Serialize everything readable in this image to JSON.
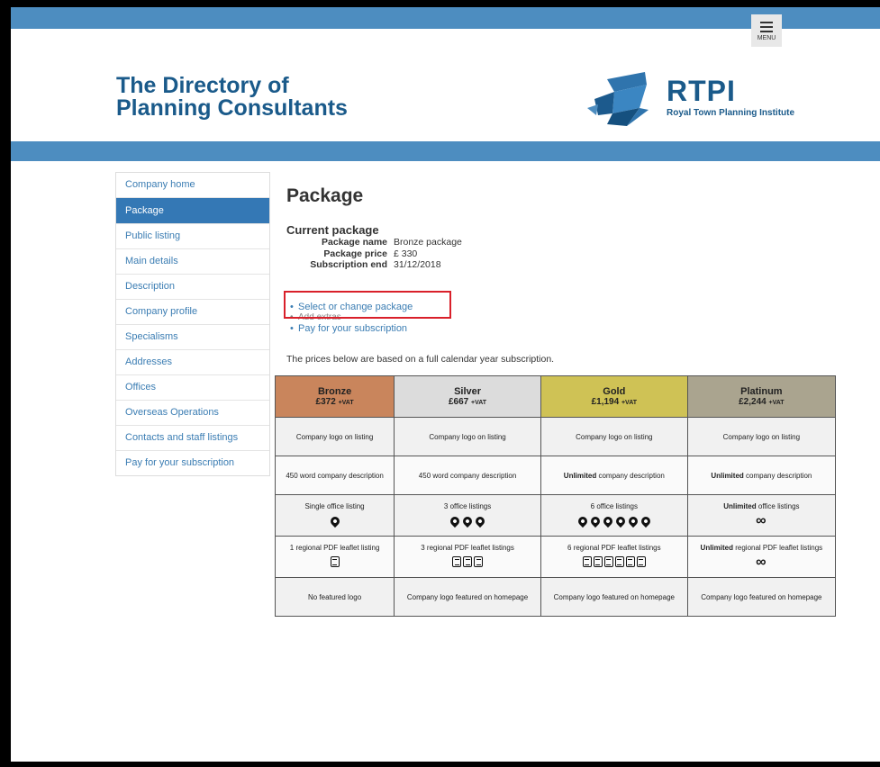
{
  "header": {
    "menu_label": "MENU",
    "site_title_line1": "The Directory of",
    "site_title_line2": "Planning Consultants",
    "logo_text": "RTPI",
    "logo_subtext": "Royal Town Planning Institute"
  },
  "sidebar": {
    "items": [
      {
        "label": "Company home"
      },
      {
        "label": "Package"
      },
      {
        "label": "Public listing"
      },
      {
        "label": "Main details"
      },
      {
        "label": "Description"
      },
      {
        "label": "Company profile"
      },
      {
        "label": "Specialisms"
      },
      {
        "label": "Addresses"
      },
      {
        "label": "Offices"
      },
      {
        "label": "Overseas Operations"
      },
      {
        "label": "Contacts and staff listings"
      },
      {
        "label": "Pay for your subscription"
      }
    ]
  },
  "main": {
    "heading": "Package",
    "current_package": {
      "title": "Current package",
      "name_label": "Package name",
      "name_value": "Bronze package",
      "price_label": "Package price",
      "price_value": "£ 330",
      "sub_end_label": "Subscription end",
      "sub_end_value": "31/12/2018"
    },
    "links": {
      "select_change": "Select or change package",
      "add_extras": "Add extras",
      "pay": "Pay for your subscription"
    },
    "prices_note": "The prices below are based on a full calendar year subscription."
  },
  "packages": {
    "vat_suffix": "+VAT",
    "tiers": [
      {
        "name": "Bronze",
        "price": "£372",
        "color": "#c9855c"
      },
      {
        "name": "Silver",
        "price": "£667",
        "color": "#dcdcdc"
      },
      {
        "name": "Gold",
        "price": "£1,194",
        "color": "#cfc255"
      },
      {
        "name": "Platinum",
        "price": "£2,244",
        "color": "#aaa48f"
      }
    ],
    "row_logo": [
      "Company logo on listing",
      "Company logo on listing",
      "Company logo on listing",
      "Company logo on listing"
    ],
    "row_desc": {
      "bronze": "450 word company description",
      "silver": "450 word company description",
      "unlimited_word": "Unlimited",
      "gold_rest": " company description",
      "platinum_rest": " company description"
    },
    "row_offices": {
      "bronze": "Single office listing",
      "silver": "3 office listings",
      "gold": "6 office listings",
      "platinum_bold": "Unlimited",
      "platinum_rest": " office listings",
      "bronze_count": 1,
      "silver_count": 3,
      "gold_count": 6,
      "platinum_icon": "infinity-icon"
    },
    "row_pdf": {
      "bronze": "1 regional PDF leaflet listing",
      "silver": "3 regional PDF leaflet listings",
      "gold": "6 regional PDF leaflet listings",
      "platinum_bold": "Unlimited",
      "platinum_rest": " regional PDF leaflet listings",
      "bronze_count": 1,
      "silver_count": 3,
      "gold_count": 6,
      "platinum_icon": "infinity-icon"
    },
    "row_featured": [
      "No featured logo",
      "Company logo featured on homepage",
      "Company logo featured on homepage",
      "Company logo featured on homepage"
    ]
  }
}
